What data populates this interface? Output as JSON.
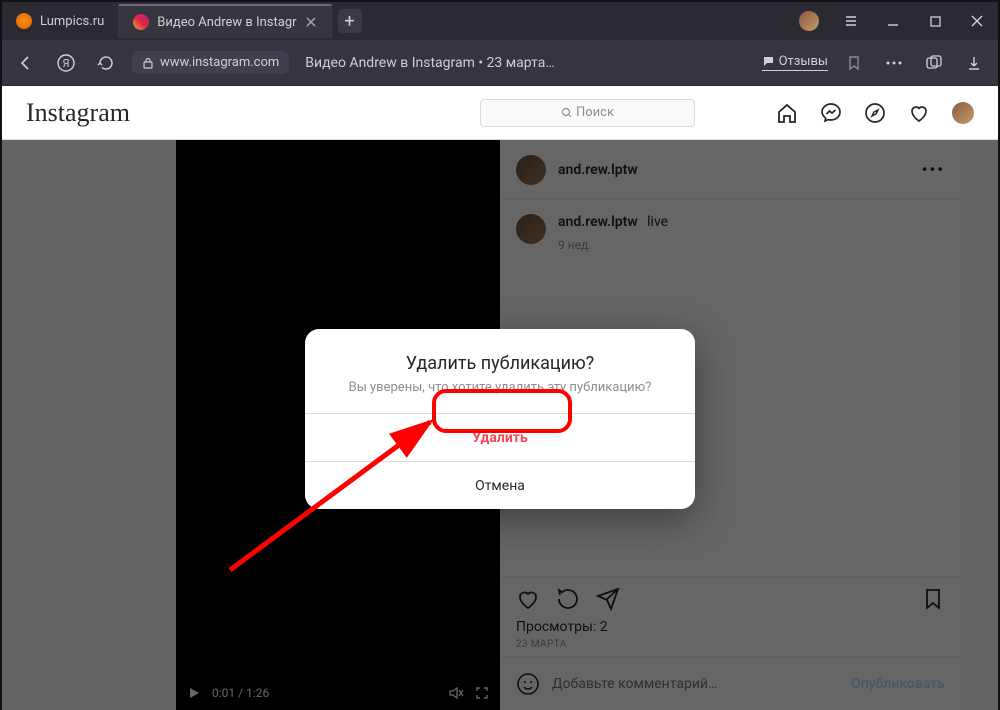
{
  "tabs": {
    "inactive": {
      "title": "Lumpics.ru"
    },
    "active": {
      "title": "Видео Andrew в Instagr"
    }
  },
  "addressbar": {
    "domain": "www.instagram.com",
    "page_title": "Видео Andrew в Instagram • 23 марта…",
    "reviews": "Отзывы"
  },
  "ig": {
    "search_placeholder": "Поиск",
    "logo": "Instagram"
  },
  "post": {
    "username": "and.rew.lptw",
    "caption": "live",
    "age": "9 нед.",
    "time": "0:01 / 1:26",
    "views": "Просмотры: 2",
    "date": "23 МАРТА",
    "comment_placeholder": "Добавьте комментарий…",
    "publish": "Опубликовать"
  },
  "dialog": {
    "title": "Удалить публикацию?",
    "subtitle": "Вы уверены, что хотите удалить эту публикацию?",
    "delete": "Удалить",
    "cancel": "Отмена"
  }
}
